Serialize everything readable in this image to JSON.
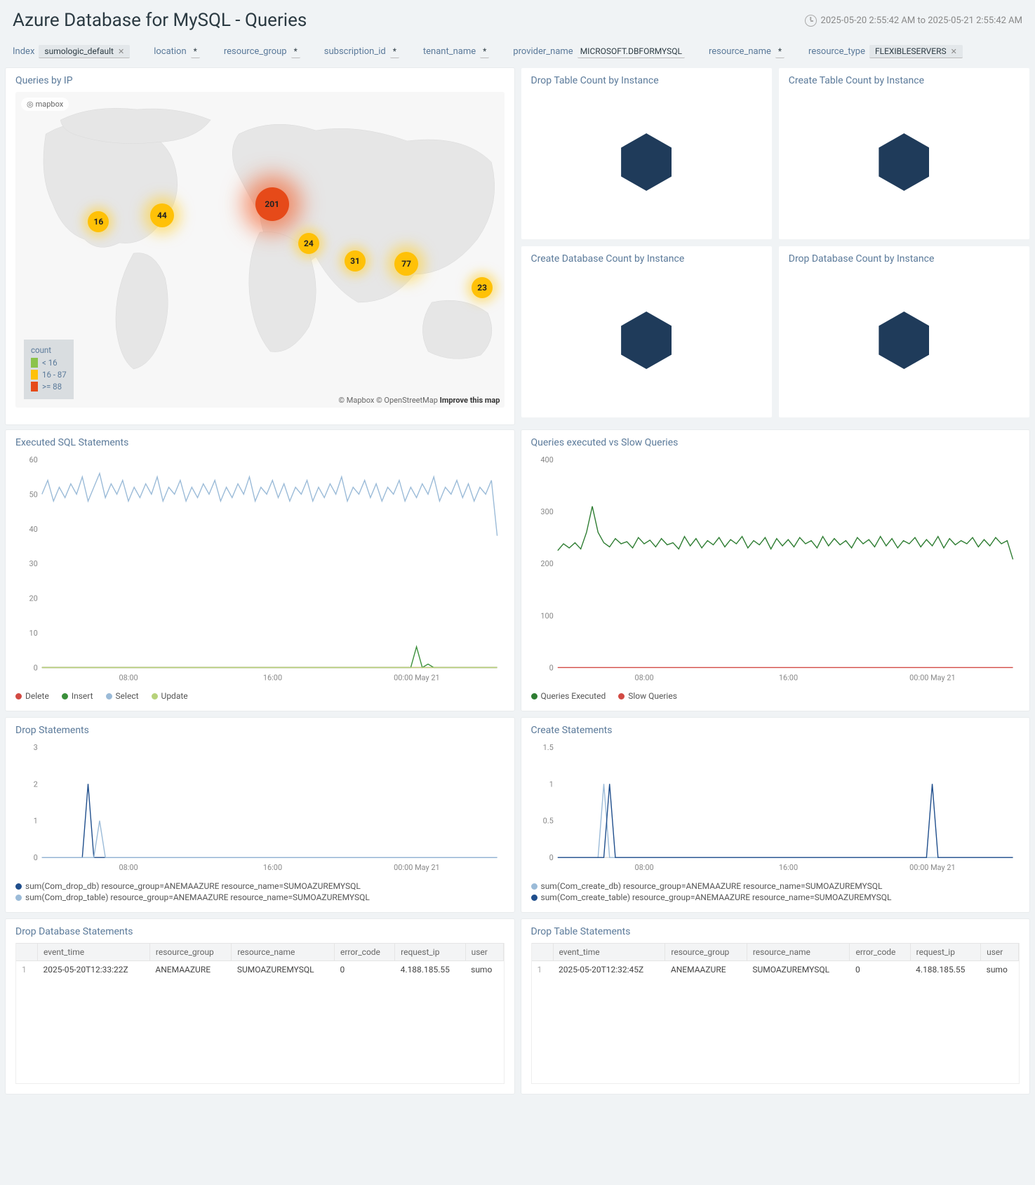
{
  "header": {
    "title": "Azure Database for MySQL - Queries",
    "timerange": "2025-05-20 2:55:42 AM to 2025-05-21 2:55:42 AM"
  },
  "filters": {
    "index_label": "Index",
    "index_value": "sumologic_default",
    "location_label": "location",
    "location_value": "*",
    "resource_group_label": "resource_group",
    "resource_group_value": "*",
    "subscription_id_label": "subscription_id",
    "subscription_id_value": "*",
    "tenant_name_label": "tenant_name",
    "tenant_name_value": "*",
    "provider_name_label": "provider_name",
    "provider_name_value": "MICROSOFT.DBFORMYSQL",
    "resource_name_label": "resource_name",
    "resource_name_value": "*",
    "resource_type_label": "resource_type",
    "resource_type_value": "FLEXIBLESERVERS"
  },
  "panels": {
    "queries_by_ip": "Queries by IP",
    "drop_table_by_instance": "Drop Table Count by Instance",
    "create_table_by_instance": "Create Table Count by Instance",
    "create_db_by_instance": "Create Database Count by Instance",
    "drop_db_by_instance": "Drop Database Count by Instance",
    "executed_sql": "Executed SQL Statements",
    "queries_vs_slow": "Queries executed vs Slow Queries",
    "drop_stmts": "Drop Statements",
    "create_stmts": "Create Statements",
    "drop_db_stmts": "Drop Database Statements",
    "drop_tbl_stmts": "Drop Table Statements"
  },
  "map": {
    "legend_title": "count",
    "legend": [
      {
        "color": "#8BC34A",
        "label": "< 16"
      },
      {
        "color": "#FFC107",
        "label": "16 - 87"
      },
      {
        "color": "#E64A19",
        "label": ">= 88"
      }
    ],
    "attribution": "© Mapbox © OpenStreetMap",
    "improve": "Improve this map",
    "mapbox": "mapbox",
    "bubbles": [
      {
        "x": 17,
        "y": 41,
        "v": 16,
        "c": "#FFC107",
        "s": "small"
      },
      {
        "x": 30,
        "y": 39,
        "v": 44,
        "c": "#FFC107",
        "s": "med"
      },
      {
        "x": 52.5,
        "y": 35.5,
        "v": 201,
        "c": "#E64A19",
        "s": "big"
      },
      {
        "x": 60,
        "y": 48,
        "v": 24,
        "c": "#FFC107",
        "s": "small"
      },
      {
        "x": 69.5,
        "y": 53.5,
        "v": 31,
        "c": "#FFC107",
        "s": "small"
      },
      {
        "x": 80,
        "y": 54.5,
        "v": 77,
        "c": "#FFC107",
        "s": "med"
      },
      {
        "x": 95.5,
        "y": 62,
        "v": 23,
        "c": "#FFC107",
        "s": "small"
      }
    ]
  },
  "chart_data": [
    {
      "id": "executed_sql",
      "type": "line",
      "xlabel": "",
      "ylabel": "",
      "x_ticks": [
        "08:00",
        "16:00",
        "00:00 May 21"
      ],
      "ylim": [
        0,
        60
      ],
      "y_ticks": [
        0,
        10,
        20,
        30,
        40,
        50,
        60
      ],
      "series": [
        {
          "name": "Delete",
          "color": "#d24a43",
          "values": [
            0,
            0,
            0,
            0,
            0,
            0,
            0,
            0,
            0,
            0,
            0,
            0,
            0,
            0,
            0,
            0,
            0,
            0,
            0,
            0,
            0,
            0,
            0,
            0,
            0,
            0,
            0,
            0,
            0,
            0,
            0,
            0,
            0,
            0,
            0,
            0,
            0,
            0,
            0,
            0,
            0,
            0,
            0,
            0,
            0,
            0,
            0,
            0,
            0,
            0,
            0,
            0,
            0,
            0,
            0,
            0,
            0,
            0,
            0,
            0,
            0,
            0,
            0,
            0,
            0,
            0,
            0,
            0,
            0,
            0,
            0,
            0,
            0,
            0,
            0,
            0,
            0,
            0,
            0,
            0
          ]
        },
        {
          "name": "Insert",
          "color": "#3a8f3a",
          "values": [
            0,
            0,
            0,
            0,
            0,
            0,
            0,
            0,
            0,
            0,
            0,
            0,
            0,
            0,
            0,
            0,
            0,
            0,
            0,
            0,
            0,
            0,
            0,
            0,
            0,
            0,
            0,
            0,
            0,
            0,
            0,
            0,
            0,
            0,
            0,
            0,
            0,
            0,
            0,
            0,
            0,
            0,
            0,
            0,
            0,
            0,
            0,
            0,
            0,
            0,
            0,
            0,
            0,
            0,
            0,
            0,
            0,
            0,
            0,
            0,
            0,
            0,
            0,
            0,
            0,
            6,
            0,
            1,
            0,
            0,
            0,
            0,
            0,
            0,
            0,
            0,
            0,
            0,
            0,
            0
          ]
        },
        {
          "name": "Select",
          "color": "#9bbbd8",
          "values": [
            50,
            54,
            48,
            52,
            49,
            53,
            50,
            55,
            48,
            52,
            56,
            49,
            53,
            50,
            54,
            48,
            52,
            49,
            53,
            50,
            55,
            48,
            52,
            50,
            54,
            48,
            52,
            49,
            53,
            50,
            54,
            48,
            52,
            49,
            53,
            50,
            55,
            48,
            52,
            50,
            54,
            49,
            53,
            48,
            52,
            50,
            54,
            48,
            52,
            49,
            53,
            50,
            55,
            48,
            52,
            50,
            54,
            49,
            53,
            48,
            52,
            50,
            54,
            48,
            52,
            49,
            53,
            50,
            55,
            48,
            52,
            50,
            54,
            49,
            53,
            48,
            52,
            50,
            54,
            38
          ]
        },
        {
          "name": "Update",
          "color": "#b7d27a",
          "values": [
            0,
            0,
            0,
            0,
            0,
            0,
            0,
            0,
            0,
            0,
            0,
            0,
            0,
            0,
            0,
            0,
            0,
            0,
            0,
            0,
            0,
            0,
            0,
            0,
            0,
            0,
            0,
            0,
            0,
            0,
            0,
            0,
            0,
            0,
            0,
            0,
            0,
            0,
            0,
            0,
            0,
            0,
            0,
            0,
            0,
            0,
            0,
            0,
            0,
            0,
            0,
            0,
            0,
            0,
            0,
            0,
            0,
            0,
            0,
            0,
            0,
            0,
            0,
            0,
            0,
            0,
            0,
            0,
            0,
            0,
            0,
            0,
            0,
            0,
            0,
            0,
            0,
            0,
            0,
            0
          ]
        }
      ]
    },
    {
      "id": "queries_vs_slow",
      "type": "line",
      "x_ticks": [
        "08:00",
        "16:00",
        "00:00 May 21"
      ],
      "ylim": [
        0,
        400
      ],
      "y_ticks": [
        0,
        100,
        200,
        300,
        400
      ],
      "series": [
        {
          "name": "Queries Executed",
          "color": "#2e7d32",
          "values": [
            225,
            238,
            230,
            240,
            228,
            260,
            310,
            260,
            240,
            232,
            248,
            238,
            242,
            230,
            250,
            238,
            245,
            232,
            248,
            236,
            240,
            228,
            252,
            234,
            248,
            230,
            244,
            236,
            250,
            232,
            246,
            238,
            252,
            230,
            244,
            236,
            250,
            228,
            248,
            234,
            246,
            232,
            250,
            238,
            244,
            230,
            252,
            234,
            248,
            236,
            244,
            230,
            250,
            238,
            246,
            232,
            252,
            234,
            248,
            230,
            244,
            238,
            250,
            232,
            246,
            234,
            252,
            230,
            248,
            236,
            244,
            238,
            250,
            232,
            246,
            234,
            250,
            238,
            244,
            208
          ]
        },
        {
          "name": "Slow Queries",
          "color": "#d24a43",
          "values": [
            0,
            0,
            0,
            0,
            0,
            0,
            0,
            0,
            0,
            0,
            0,
            0,
            0,
            0,
            0,
            0,
            0,
            0,
            0,
            0,
            0,
            0,
            0,
            0,
            0,
            0,
            0,
            0,
            0,
            0,
            0,
            0,
            0,
            0,
            0,
            0,
            0,
            0,
            0,
            0,
            0,
            0,
            0,
            0,
            0,
            0,
            0,
            0,
            0,
            0,
            0,
            0,
            0,
            0,
            0,
            0,
            0,
            0,
            0,
            0,
            0,
            0,
            0,
            0,
            0,
            0,
            0,
            0,
            0,
            0,
            0,
            0,
            0,
            0,
            0,
            0,
            0,
            0,
            0,
            0
          ]
        }
      ]
    },
    {
      "id": "drop_stmts",
      "type": "line",
      "x_ticks": [
        "08:00",
        "16:00",
        "00:00 May 21"
      ],
      "ylim": [
        0,
        3
      ],
      "y_ticks": [
        0,
        1,
        2,
        3
      ],
      "series": [
        {
          "name": "sum(Com_drop_db) resource_group=ANEMAAZURE resource_name=SUMOAZUREMYSQL",
          "color": "#1f4e8c",
          "values": [
            0,
            0,
            0,
            0,
            0,
            0,
            0,
            0,
            2,
            0,
            0,
            0,
            0,
            0,
            0,
            0,
            0,
            0,
            0,
            0,
            0,
            0,
            0,
            0,
            0,
            0,
            0,
            0,
            0,
            0,
            0,
            0,
            0,
            0,
            0,
            0,
            0,
            0,
            0,
            0,
            0,
            0,
            0,
            0,
            0,
            0,
            0,
            0,
            0,
            0,
            0,
            0,
            0,
            0,
            0,
            0,
            0,
            0,
            0,
            0,
            0,
            0,
            0,
            0,
            0,
            0,
            0,
            0,
            0,
            0,
            0,
            0,
            0,
            0,
            0,
            0,
            0,
            0,
            0,
            0
          ]
        },
        {
          "name": "sum(Com_drop_table) resource_group=ANEMAAZURE resource_name=SUMOAZUREMYSQL",
          "color": "#9bbbd8",
          "values": [
            0,
            0,
            0,
            0,
            0,
            0,
            0,
            0,
            0,
            0,
            1,
            0,
            0,
            0,
            0,
            0,
            0,
            0,
            0,
            0,
            0,
            0,
            0,
            0,
            0,
            0,
            0,
            0,
            0,
            0,
            0,
            0,
            0,
            0,
            0,
            0,
            0,
            0,
            0,
            0,
            0,
            0,
            0,
            0,
            0,
            0,
            0,
            0,
            0,
            0,
            0,
            0,
            0,
            0,
            0,
            0,
            0,
            0,
            0,
            0,
            0,
            0,
            0,
            0,
            0,
            0,
            0,
            0,
            0,
            0,
            0,
            0,
            0,
            0,
            0,
            0,
            0,
            0,
            0,
            0
          ]
        }
      ]
    },
    {
      "id": "create_stmts",
      "type": "line",
      "x_ticks": [
        "08:00",
        "16:00",
        "00:00 May 21"
      ],
      "ylim": [
        0,
        1.5
      ],
      "y_ticks": [
        0,
        0.5,
        1,
        1.5
      ],
      "series": [
        {
          "name": "sum(Com_create_db) resource_group=ANEMAAZURE resource_name=SUMOAZUREMYSQL",
          "color": "#9bbbd8",
          "values": [
            0,
            0,
            0,
            0,
            0,
            0,
            0,
            0,
            1,
            0,
            0,
            0,
            0,
            0,
            0,
            0,
            0,
            0,
            0,
            0,
            0,
            0,
            0,
            0,
            0,
            0,
            0,
            0,
            0,
            0,
            0,
            0,
            0,
            0,
            0,
            0,
            0,
            0,
            0,
            0,
            0,
            0,
            0,
            0,
            0,
            0,
            0,
            0,
            0,
            0,
            0,
            0,
            0,
            0,
            0,
            0,
            0,
            0,
            0,
            0,
            0,
            0,
            0,
            0,
            0,
            0,
            0,
            0,
            0,
            0,
            0,
            0,
            0,
            0,
            0,
            0,
            0,
            0,
            0,
            0
          ]
        },
        {
          "name": "sum(Com_create_table) resource_group=ANEMAAZURE resource_name=SUMOAZUREMYSQL",
          "color": "#1f4e8c",
          "values": [
            0,
            0,
            0,
            0,
            0,
            0,
            0,
            0,
            0,
            1,
            0,
            0,
            0,
            0,
            0,
            0,
            0,
            0,
            0,
            0,
            0,
            0,
            0,
            0,
            0,
            0,
            0,
            0,
            0,
            0,
            0,
            0,
            0,
            0,
            0,
            0,
            0,
            0,
            0,
            0,
            0,
            0,
            0,
            0,
            0,
            0,
            0,
            0,
            0,
            0,
            0,
            0,
            0,
            0,
            0,
            0,
            0,
            0,
            0,
            0,
            0,
            0,
            0,
            0,
            0,
            1,
            0,
            0,
            0,
            0,
            0,
            0,
            0,
            0,
            0,
            0,
            0,
            0,
            0,
            0
          ]
        }
      ]
    }
  ],
  "tables": {
    "columns": [
      "event_time",
      "resource_group",
      "resource_name",
      "error_code",
      "request_ip",
      "user"
    ],
    "drop_db_rows": [
      {
        "event_time": "2025-05-20T12:33:22Z",
        "resource_group": "ANEMAAZURE",
        "resource_name": "SUMOAZUREMYSQL",
        "error_code": "0",
        "request_ip": "4.188.185.55",
        "user": "sumo"
      }
    ],
    "drop_tbl_rows": [
      {
        "event_time": "2025-05-20T12:32:45Z",
        "resource_group": "ANEMAAZURE",
        "resource_name": "SUMOAZUREMYSQL",
        "error_code": "0",
        "request_ip": "4.188.185.55",
        "user": "sumo"
      }
    ]
  }
}
